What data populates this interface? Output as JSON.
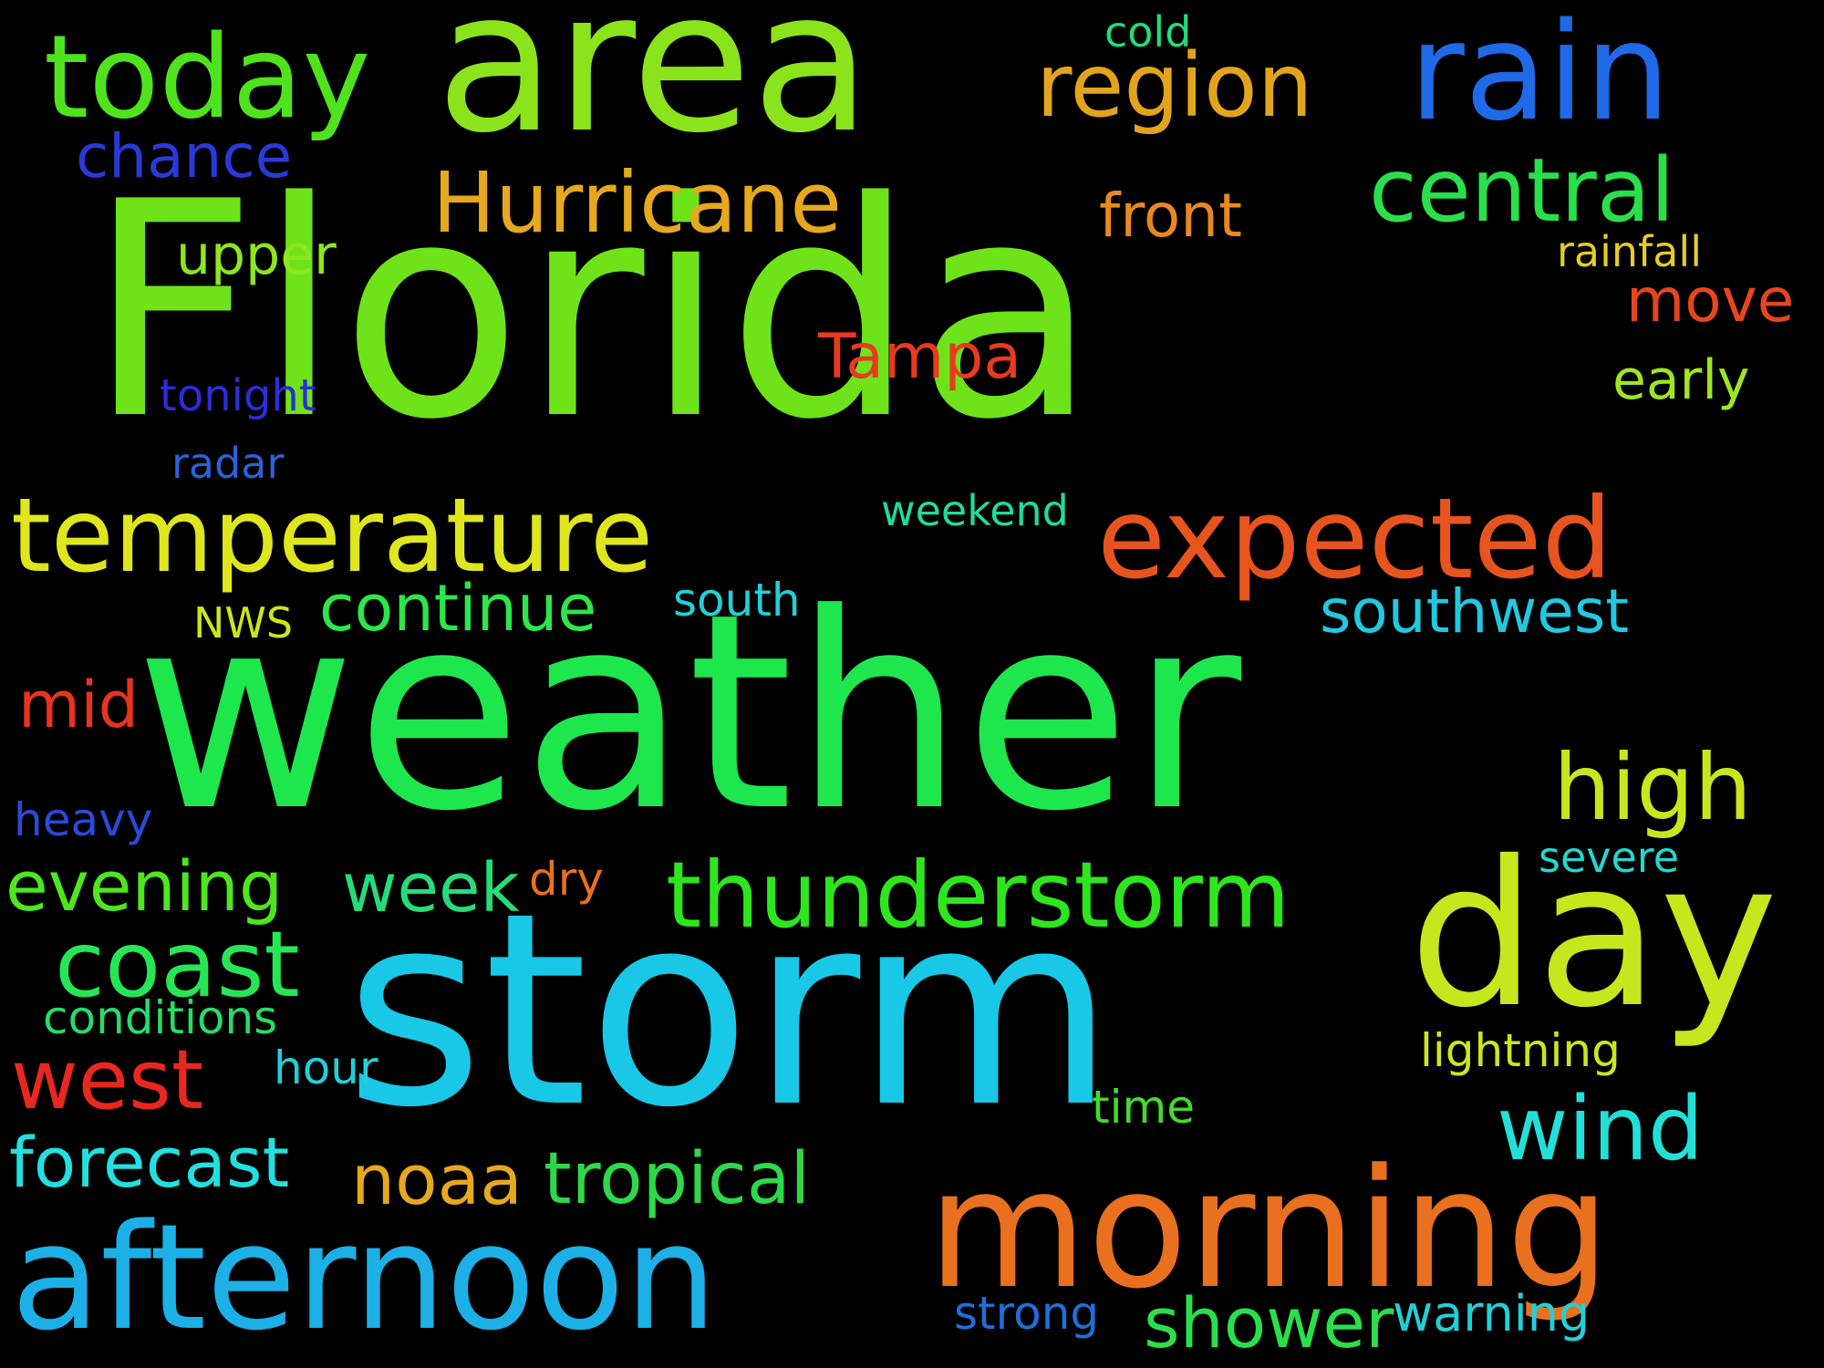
{
  "background_color": "#000000",
  "words": [
    {
      "text": "Florida",
      "color": "#6ee31a"
    },
    {
      "text": "weather",
      "color": "#1ee64d"
    },
    {
      "text": "storm",
      "color": "#18c8e6"
    },
    {
      "text": "area",
      "color": "#8be31c"
    },
    {
      "text": "rain",
      "color": "#1f6ae6"
    },
    {
      "text": "today",
      "color": "#4fe31d"
    },
    {
      "text": "region",
      "color": "#e3a41c"
    },
    {
      "text": "cold",
      "color": "#22dc7a"
    },
    {
      "text": "chance",
      "color": "#2a3ad8"
    },
    {
      "text": "Hurricane",
      "color": "#e6a81e"
    },
    {
      "text": "central",
      "color": "#2ae04a"
    },
    {
      "text": "front",
      "color": "#e8881e"
    },
    {
      "text": "upper",
      "color": "#8ee61e"
    },
    {
      "text": "rainfall",
      "color": "#e6cc26"
    },
    {
      "text": "move",
      "color": "#e6461e"
    },
    {
      "text": "Tampa",
      "color": "#e83a1e"
    },
    {
      "text": "early",
      "color": "#9fe61e"
    },
    {
      "text": "tonight",
      "color": "#2a2ed8"
    },
    {
      "text": "radar",
      "color": "#2a62d8"
    },
    {
      "text": "temperature",
      "color": "#e0e61e"
    },
    {
      "text": "weekend",
      "color": "#22dc9a"
    },
    {
      "text": "expected",
      "color": "#e8541e"
    },
    {
      "text": "continue",
      "color": "#2ce64a"
    },
    {
      "text": "south",
      "color": "#22d0d8"
    },
    {
      "text": "southwest",
      "color": "#22c8e0"
    },
    {
      "text": "NWS",
      "color": "#cce61e"
    },
    {
      "text": "mid",
      "color": "#e8341e"
    },
    {
      "text": "high",
      "color": "#c8e61e"
    },
    {
      "text": "heavy",
      "color": "#2a4ad8"
    },
    {
      "text": "severe",
      "color": "#22d8d0"
    },
    {
      "text": "evening",
      "color": "#4ee61e"
    },
    {
      "text": "week",
      "color": "#26dc7a"
    },
    {
      "text": "dry",
      "color": "#e8701e"
    },
    {
      "text": "thunderstorm",
      "color": "#2ee61e"
    },
    {
      "text": "day",
      "color": "#c6e61e"
    },
    {
      "text": "coast",
      "color": "#26e656"
    },
    {
      "text": "conditions",
      "color": "#26dc6a"
    },
    {
      "text": "west",
      "color": "#e8281e"
    },
    {
      "text": "hour",
      "color": "#22d0d8"
    },
    {
      "text": "lightning",
      "color": "#cce61e"
    },
    {
      "text": "time",
      "color": "#42dc2a"
    },
    {
      "text": "wind",
      "color": "#22e0d8"
    },
    {
      "text": "forecast",
      "color": "#22e0e0"
    },
    {
      "text": "noaa",
      "color": "#e6a81e"
    },
    {
      "text": "tropical",
      "color": "#2ed84a"
    },
    {
      "text": "morning",
      "color": "#e8701e"
    },
    {
      "text": "afternoon",
      "color": "#1cb0e6"
    },
    {
      "text": "strong",
      "color": "#1e70d8"
    },
    {
      "text": "shower",
      "color": "#2ae04a"
    },
    {
      "text": "warning",
      "color": "#22d0d8"
    }
  ]
}
